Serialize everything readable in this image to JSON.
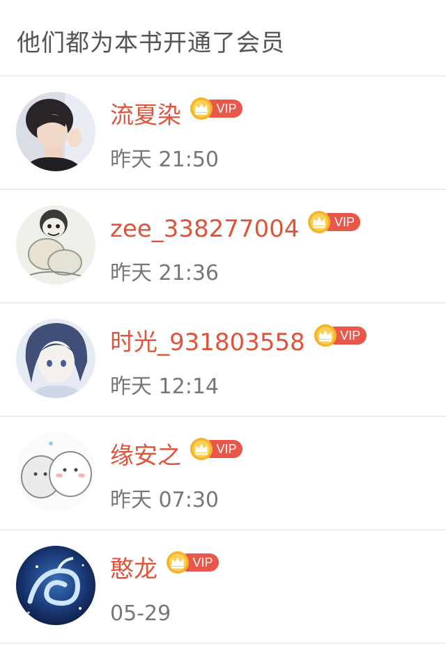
{
  "header": {
    "title": "他们都为本书开通了会员"
  },
  "vip_label": "VIP",
  "colors": {
    "username": "#e0533a",
    "vip_pill": "#e8574a",
    "crown": "#f5b325",
    "divider": "#ececec"
  },
  "members": [
    {
      "name": "流夏染",
      "time": "昨天 21:50",
      "avatar": "boy-portrait"
    },
    {
      "name": "zee_338277004",
      "time": "昨天 21:36",
      "avatar": "cartoon-sketch"
    },
    {
      "name": "时光_931803558",
      "time": "昨天 12:14",
      "avatar": "anime-character"
    },
    {
      "name": "缘安之",
      "time": "昨天 07:30",
      "avatar": "cute-cats"
    },
    {
      "name": "憨龙",
      "time": "05-29",
      "avatar": "blue-dragon"
    }
  ]
}
